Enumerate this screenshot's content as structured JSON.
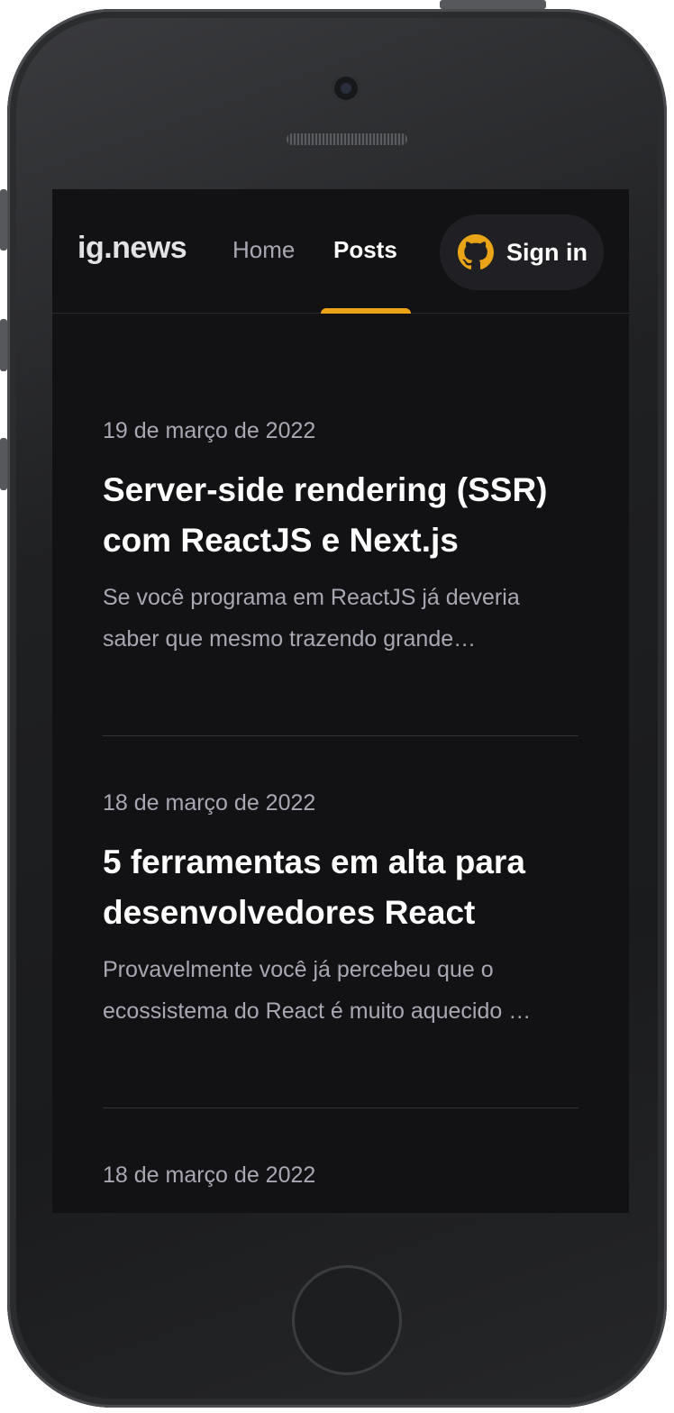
{
  "header": {
    "logo": "ig.news",
    "nav": [
      {
        "label": "Home"
      },
      {
        "label": "Posts"
      }
    ],
    "signin_label": "Sign in"
  },
  "posts": [
    {
      "date": "19 de março de 2022",
      "title": "Server-side rendering (SSR) com ReactJS e Next.js",
      "excerpt_lines": [
        "Se você programa em ReactJS já deveria",
        "saber que mesmo trazendo grande…"
      ]
    },
    {
      "date": "18 de março de 2022",
      "title": "5 ferramentas em alta para desenvolvedores React",
      "excerpt_lines": [
        "Provavelmente você já percebeu que o",
        "ecossistema do React é muito aquecido …"
      ]
    },
    {
      "date": "18 de março de 2022"
    }
  ],
  "colors": {
    "background": "#121214",
    "accent": "#eba417",
    "text_primary": "#ffffff",
    "text_secondary": "#a8a8b3",
    "signin_bg": "#202024"
  }
}
